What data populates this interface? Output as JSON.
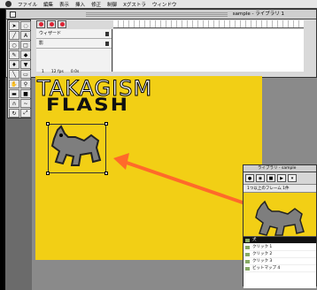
{
  "menubar": {
    "items": [
      "ファイル",
      "編集",
      "表示",
      "挿入",
      "修正",
      "制御",
      "Xグストラ",
      "ウィンドウ"
    ]
  },
  "timeline": {
    "title": "sample - ライブラリ 1",
    "layers": [
      "ウィザード",
      "影"
    ],
    "status": [
      "1",
      "12 fps",
      "0.0s"
    ]
  },
  "library": {
    "title": "ライブラリ - sample",
    "info": "1つ以上のフレーム 1件",
    "items": [
      {
        "label": "犬",
        "selected": true
      },
      {
        "label": "クリック 1",
        "selected": false
      },
      {
        "label": "クリック 2",
        "selected": false
      },
      {
        "label": "クリック 3",
        "selected": false
      },
      {
        "label": "ビットマップ 4",
        "selected": false
      }
    ]
  },
  "stage": {
    "brand_line1": "TAKAGISM",
    "brand_line2": "FLASH"
  },
  "colors": {
    "stage": "#f2cf15",
    "arrow": "#ff6a2a",
    "dog": "#7e7e7e"
  },
  "icons": [
    "apple-icon",
    "lock-icon",
    "dog-icon",
    "arrow-icon",
    "play-icon",
    "pencil-icon",
    "brush-icon",
    "eraser-icon"
  ]
}
